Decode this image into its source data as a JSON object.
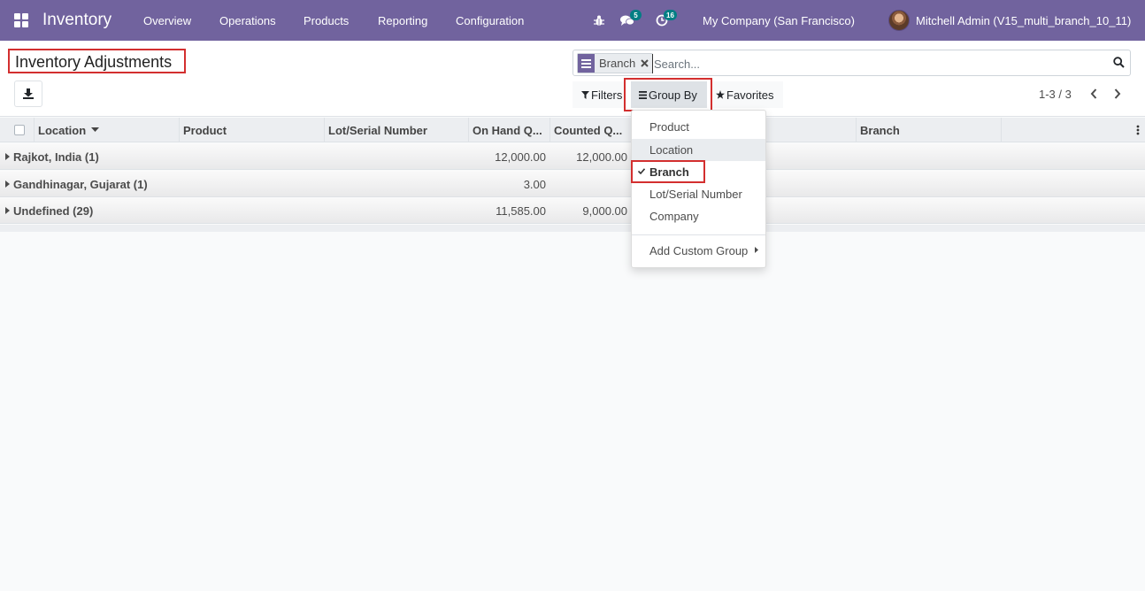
{
  "navbar": {
    "app_title": "Inventory",
    "menu": [
      "Overview",
      "Operations",
      "Products",
      "Reporting",
      "Configuration"
    ],
    "messages_count": "5",
    "activities_count": "16",
    "company": "My Company (San Francisco)",
    "user": "Mitchell Admin (V15_multi_branch_10_11)",
    "color": "#71639e"
  },
  "page": {
    "title": "Inventory Adjustments"
  },
  "search": {
    "facet_label": "Branch",
    "placeholder": "Search..."
  },
  "filters": {
    "filters_label": "Filters",
    "group_by_label": "Group By",
    "favorites_label": "Favorites"
  },
  "pager": {
    "range": "1-3 / 3"
  },
  "table": {
    "columns": [
      "Location",
      "Product",
      "Lot/Serial Number",
      "On Hand Q...",
      "Counted Q...",
      "Branch"
    ],
    "groups": [
      {
        "name": "Rajkot, India (1)",
        "on_hand": "12,000.00",
        "counted": "12,000.00"
      },
      {
        "name": "Gandhinagar, Gujarat (1)",
        "on_hand": "3.00",
        "counted": ""
      },
      {
        "name": "Undefined (29)",
        "on_hand": "11,585.00",
        "counted": "9,000.00"
      }
    ]
  },
  "group_by_menu": {
    "items": [
      "Product",
      "Location",
      "Branch",
      "Lot/Serial Number",
      "Company"
    ],
    "custom_group": "Add Custom Group"
  }
}
